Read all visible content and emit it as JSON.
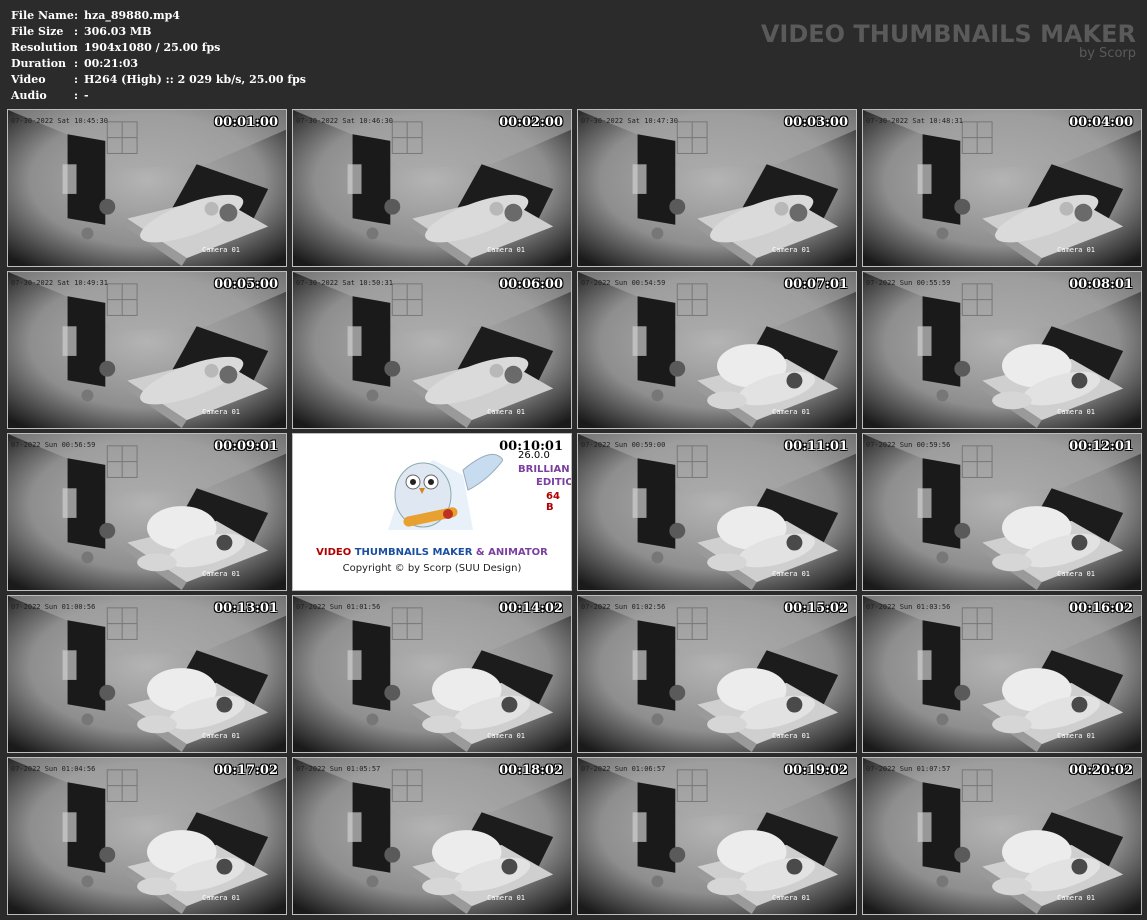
{
  "info": {
    "rows": [
      {
        "key": "File Name",
        "value": "hza_89880.mp4"
      },
      {
        "key": "File Size",
        "value": "306.03 MB"
      },
      {
        "key": "Resolution",
        "value": "1904x1080 / 25.00 fps"
      },
      {
        "key": "Duration",
        "value": "00:21:03"
      },
      {
        "key": "Video",
        "value": "H264 (High) :: 2 029 kb/s, 25.00 fps"
      },
      {
        "key": "Audio",
        "value": "-"
      }
    ]
  },
  "brand": {
    "title": "VIDEO THUMBNAILS MAKER",
    "subtitle": "by Scorp"
  },
  "thumbnails": [
    {
      "time": "00:01:00",
      "osd": "07-30-2022 Sat 10:45:30",
      "camera": "Camera 01",
      "scene": "sleep"
    },
    {
      "time": "00:02:00",
      "osd": "07-30-2022 Sat 10:46:30",
      "camera": "Camera 01",
      "scene": "sleep"
    },
    {
      "time": "00:03:00",
      "osd": "07-30-2022 Sat 10:47:30",
      "camera": "Camera 01",
      "scene": "sleep"
    },
    {
      "time": "00:04:00",
      "osd": "07-30-2022 Sat 10:48:31",
      "camera": "Camera 01",
      "scene": "sleep"
    },
    {
      "time": "00:05:00",
      "osd": "07-30-2022 Sat 10:49:31",
      "camera": "Camera 01",
      "scene": "sleep"
    },
    {
      "time": "00:06:00",
      "osd": "07-30-2022 Sat 10:50:31",
      "camera": "Camera 01",
      "scene": "sleep"
    },
    {
      "time": "00:07:01",
      "osd": "07-2022 Sun 00:54:59",
      "camera": "Camera 01",
      "scene": "bed"
    },
    {
      "time": "00:08:01",
      "osd": "07-2022 Sun 00:55:59",
      "camera": "Camera 01",
      "scene": "bed"
    },
    {
      "time": "00:09:01",
      "osd": "07-2022 Sun 00:56:59",
      "camera": "Camera 01",
      "scene": "bed"
    },
    {
      "time": "00:10:01",
      "osd": "",
      "camera": "",
      "scene": "splash"
    },
    {
      "time": "00:11:01",
      "osd": "07-2022 Sun 00:59:00",
      "camera": "Camera 01",
      "scene": "bed"
    },
    {
      "time": "00:12:01",
      "osd": "07-2022 Sun 00:59:56",
      "camera": "Camera 01",
      "scene": "bed"
    },
    {
      "time": "00:13:01",
      "osd": "07-2022 Sun 01:00:56",
      "camera": "Camera 01",
      "scene": "bed"
    },
    {
      "time": "00:14:02",
      "osd": "07-2022 Sun 01:01:56",
      "camera": "Camera 01",
      "scene": "bed"
    },
    {
      "time": "00:15:02",
      "osd": "07-2022 Sun 01:02:56",
      "camera": "Camera 01",
      "scene": "bed"
    },
    {
      "time": "00:16:02",
      "osd": "07-2022 Sun 01:03:56",
      "camera": "Camera 01",
      "scene": "bed"
    },
    {
      "time": "00:17:02",
      "osd": "07-2022 Sun 01:04:56",
      "camera": "Camera 01",
      "scene": "bed"
    },
    {
      "time": "00:18:02",
      "osd": "07-2022 Sun 01:05:57",
      "camera": "Camera 01",
      "scene": "bed"
    },
    {
      "time": "00:19:02",
      "osd": "07-2022 Sun 01:06:57",
      "camera": "Camera 01",
      "scene": "bed"
    },
    {
      "time": "00:20:02",
      "osd": "07-2022 Sun 01:07:57",
      "camera": "Camera 01",
      "scene": "bed"
    }
  ],
  "splash": {
    "version": "26.0.0",
    "edition_line1": "BRILLIAN",
    "edition_line2": "EDITIO",
    "bits": "64 B",
    "name_part1": "VIDEO ",
    "name_part2": "THUMBNAILS MAKER",
    "name_part3": " & ANIMATOR",
    "copyright": "Copyright © by Scorp (SUU Design)"
  }
}
